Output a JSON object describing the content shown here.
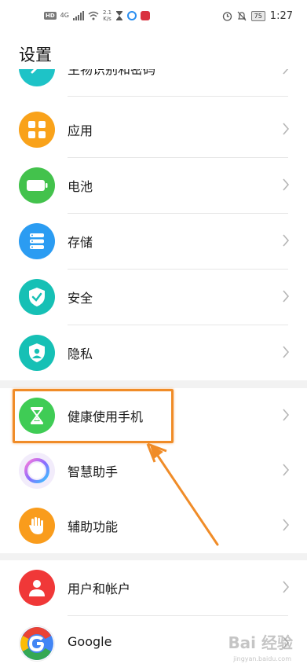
{
  "status_bar": {
    "hd": "HD",
    "network": "4G",
    "speed_top": "2.1",
    "speed_bottom": "K/s",
    "battery": "75",
    "time": "1:27"
  },
  "page_title": "设置",
  "items": [
    {
      "label": "生物识别和密码",
      "icon": "fingerprint-key-icon",
      "color": "#1ec3c7"
    },
    {
      "label": "应用",
      "icon": "apps-grid-icon",
      "color": "#f9a21a"
    },
    {
      "label": "电池",
      "icon": "battery-icon",
      "color": "#43c24c"
    },
    {
      "label": "存储",
      "icon": "storage-icon",
      "color": "#2b9cf2"
    },
    {
      "label": "安全",
      "icon": "shield-check-icon",
      "color": "#16c0b5"
    },
    {
      "label": "隐私",
      "icon": "privacy-shield-icon",
      "color": "#16c0b5"
    },
    {
      "label": "健康使用手机",
      "icon": "hourglass-icon",
      "color": "#3fcc55"
    },
    {
      "label": "智慧助手",
      "icon": "assistant-orb-icon",
      "color": "#b57cf0"
    },
    {
      "label": "辅助功能",
      "icon": "hand-icon",
      "color": "#f99c1c"
    },
    {
      "label": "用户和帐户",
      "icon": "user-icon",
      "color": "#f03838"
    },
    {
      "label": "Google",
      "icon": "google-icon",
      "color": "#4285f4"
    }
  ],
  "watermark": "Bai 经验",
  "watermark_sub": "jingyan.baidu.com"
}
